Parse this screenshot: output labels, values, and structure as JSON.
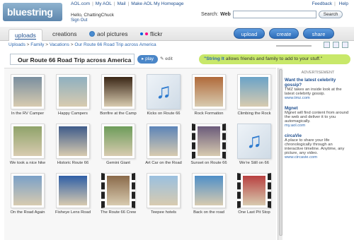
{
  "header": {
    "logo": "bluestring",
    "links": [
      "AOL.com",
      "My AOL",
      "Mail",
      "Make AOL My Homepage"
    ],
    "right_links": [
      "Feedback",
      "Help"
    ],
    "greeting": "Hello, ChattingChuck",
    "signout": "Sign Out",
    "search_label": "Search:",
    "search_scope": "Web",
    "search_value": "",
    "search_button": "Search"
  },
  "tabs": [
    "uploads",
    "creations",
    "aol pictures",
    "flickr"
  ],
  "actions": [
    "upload",
    "create",
    "share"
  ],
  "breadcrumb": [
    "Uploads",
    "Family",
    "Vacations",
    "Our Route 66 Road Trip across America"
  ],
  "album": {
    "title": "Our Route 66 Road Trip across America",
    "play": "play",
    "edit": "edit"
  },
  "promo": {
    "lead": "\"String It",
    "rest": " allows friends and family to add to your stuff.\""
  },
  "items": [
    {
      "caption": "In the RV Camper",
      "kind": "photo",
      "color": "#7a8fa0"
    },
    {
      "caption": "Happy Campers",
      "kind": "photo",
      "color": "#8fb0c0"
    },
    {
      "caption": "Bonfire at the Camp",
      "kind": "photo",
      "color": "#3a2616"
    },
    {
      "caption": "Kicks on Route 66",
      "kind": "music"
    },
    {
      "caption": "Rock Formation",
      "kind": "photo",
      "color": "#b06a3a"
    },
    {
      "caption": "Climbing the Rock",
      "kind": "photo",
      "color": "#6aa3c8"
    },
    {
      "caption": "We took a nice hike",
      "kind": "photo",
      "color": "#8fa36a"
    },
    {
      "caption": "Historic Route 66",
      "kind": "photo",
      "color": "#3e5b8a"
    },
    {
      "caption": "Gemini Giant",
      "kind": "photo",
      "color": "#6d9c5a"
    },
    {
      "caption": "Art Car on the Road",
      "kind": "photo",
      "color": "#5c84b8"
    },
    {
      "caption": "Sunset on Route 66",
      "kind": "film",
      "color": "#6a5a7a"
    },
    {
      "caption": "We're Still on 66",
      "kind": "music"
    },
    {
      "caption": "On the Road Again",
      "kind": "photo",
      "color": "#7aa0c8"
    },
    {
      "caption": "Fisheye Lens Road",
      "kind": "photo",
      "color": "#2f5fa6"
    },
    {
      "caption": "The Route 66 Crew",
      "kind": "film",
      "color": "#8a6a4a"
    },
    {
      "caption": "Teepee hotels",
      "kind": "photo",
      "color": "#9ac0e0"
    },
    {
      "caption": "Back on the road",
      "kind": "photo",
      "color": "#4f8fc8"
    },
    {
      "caption": "One Last Pit Stop",
      "kind": "film",
      "color": "#b84040"
    }
  ],
  "ads": {
    "heading": "ADVERTISEMENT",
    "list": [
      {
        "title": "Want the latest celebrity gossip?",
        "body": "TMZ takes an inside look at the latest celebrity gossip.",
        "url": "www.tmz.com"
      },
      {
        "title": "Mgnet",
        "body": "Mgnet will find content from around the web and deliver it to you automagically.",
        "url": "my.aol.com"
      },
      {
        "title": "circaVie",
        "body": "A place to share your life chronologically through an interactive timeline. Anytime, any picture, any video.",
        "url": "www.circavie.com"
      }
    ]
  }
}
